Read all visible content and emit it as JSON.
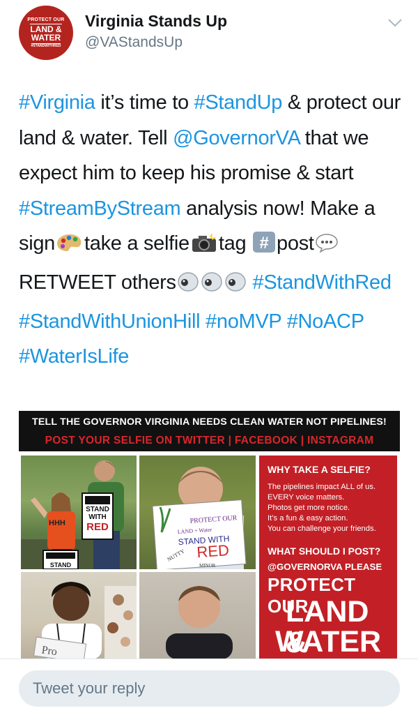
{
  "account": {
    "display_name": "Virginia Stands Up",
    "handle": "@VAStandsUp",
    "avatar_lines": [
      "PROTECT OUR",
      "LAND &",
      "WATER",
      "#STANDWITHRED"
    ]
  },
  "tweet": {
    "segments": [
      {
        "t": "#Virginia",
        "link": true
      },
      {
        "t": " it’s time to "
      },
      {
        "t": "#StandUp",
        "link": true
      },
      {
        "t": " & protect our land & water. Tell "
      },
      {
        "t": "@GovernorVA",
        "link": true
      },
      {
        "t": " that we expect him to keep his promise & start "
      },
      {
        "t": "#StreamByStream",
        "link": true
      },
      {
        "t": " analysis now! Make a sign"
      },
      {
        "emoji": "palette-icon"
      },
      {
        "t": "take a selfie"
      },
      {
        "emoji": "camera-flash-icon"
      },
      {
        "t": "tag "
      },
      {
        "emoji": "hashtag-keycap-icon"
      },
      {
        "t": "post"
      },
      {
        "emoji": "speech-balloon-icon"
      },
      {
        "t": " RETWEET others"
      },
      {
        "emoji": "eyes-icon"
      },
      {
        "emoji": "eyes-icon"
      },
      {
        "emoji": "eyes-icon"
      },
      {
        "t": " "
      },
      {
        "t": "#StandWithRed",
        "link": true
      },
      {
        "t": " "
      },
      {
        "t": "#StandWithUnionHill",
        "link": true
      },
      {
        "t": " "
      },
      {
        "t": "#noMVP",
        "link": true
      },
      {
        "t": " "
      },
      {
        "t": "#NoACP",
        "link": true
      },
      {
        "t": " "
      },
      {
        "t": "#WaterIsLife",
        "link": true
      }
    ]
  },
  "media": {
    "banner_line1": "TELL THE GOVERNOR VIRGINIA NEEDS CLEAN WATER NOT PIPELINES!",
    "banner_line2": "POST YOUR SELFIE ON TWITTER | FACEBOOK | INSTAGRAM",
    "sign1_lines": [
      "STAND",
      "WITH",
      "RED"
    ],
    "sign2_lines": [
      "PROTECT OUR",
      "LAND + Water",
      "STAND WITH",
      "RED",
      "NUTTY",
      "MINOR"
    ],
    "sign3_text": "STAND",
    "panel": {
      "q1": "WHY TAKE A SELFIE?",
      "reasons": [
        "The pipelines impact ALL of us.",
        "EVERY voice matters.",
        "Photos get more notice.",
        "It’s a fun & easy action.",
        "You can challenge your friends."
      ],
      "q2": "WHAT SHOULD I POST?",
      "gov": "@GOVERNORVA PLEASE",
      "protect": "PROTECT OUR",
      "land": "LAND &",
      "water": "WATER"
    }
  },
  "reply": {
    "placeholder": "Tweet your reply"
  },
  "colors": {
    "link": "#1b95e0",
    "panel_red": "#c22026",
    "muted": "#657786"
  }
}
